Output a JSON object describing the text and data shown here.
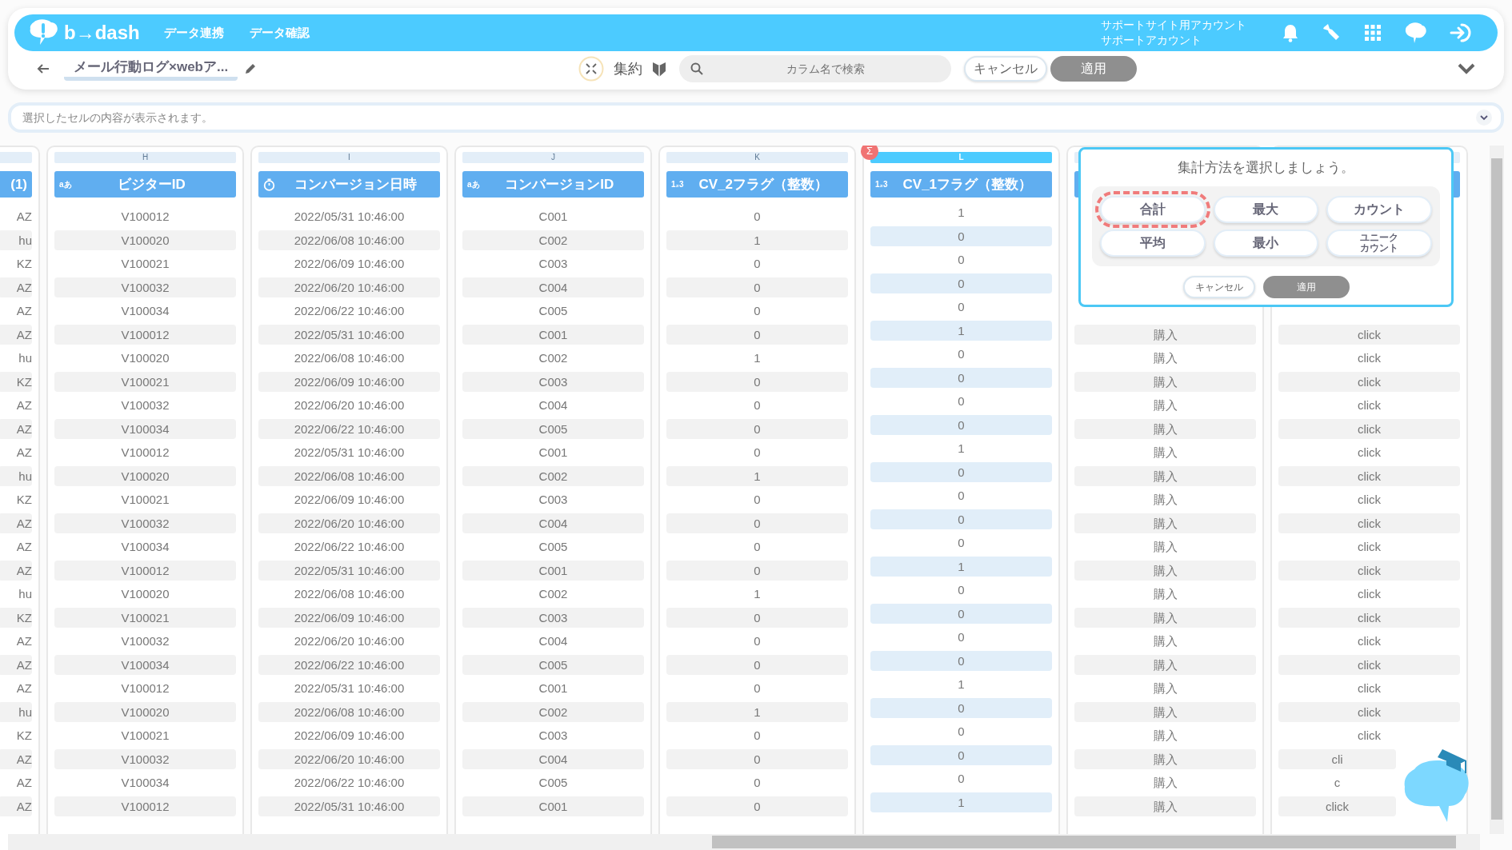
{
  "header": {
    "logo": "b→dash",
    "nav": [
      {
        "label": "データ連携"
      },
      {
        "label": "データ確認"
      }
    ],
    "account": [
      "サポートサイト用アカウント",
      "サポートアカウント"
    ]
  },
  "toolbar": {
    "title": "メール行動ログ×webア...",
    "aggregate_label": "集約",
    "search": {
      "placeholder": "カラム名で検索"
    },
    "buttons": [
      {
        "label": "キャンセル",
        "disabled": false
      },
      {
        "label": "適用",
        "disabled": true
      }
    ]
  },
  "cell_viewer": {
    "placeholder": "選択したセルの内容が表示されます。"
  },
  "table": {
    "columns": [
      {
        "title": "(1)",
        "selected": false
      },
      {
        "letter": "H",
        "kind": "text",
        "type_label": "aあ",
        "title": "ビジターID",
        "selected": false
      },
      {
        "letter": "I",
        "kind": "datetime",
        "title": "コンバージョン日時",
        "selected": false
      },
      {
        "letter": "J",
        "kind": "text",
        "type_label": "aあ",
        "title": "コンバージョンID",
        "selected": false
      },
      {
        "letter": "K",
        "kind": "number",
        "type_label": "1₂3",
        "title": "CV_2フラグ（整数）",
        "selected": false
      },
      {
        "letter": "L",
        "kind": "number",
        "type_label": "1₂3",
        "title": "CV_1フラグ（整数）",
        "selected": true,
        "badge": "Σ"
      },
      {
        "selected": false
      },
      {
        "selected": false
      }
    ],
    "rows": [
      [
        "AZ",
        "V100012",
        "2022/05/31 10:46:00",
        "C001",
        "0",
        "1"
      ],
      [
        "hu",
        "V100020",
        "2022/06/08 10:46:00",
        "C002",
        "1",
        "0"
      ],
      [
        "KZ",
        "V100021",
        "2022/06/09 10:46:00",
        "C003",
        "0",
        "0"
      ],
      [
        "AZ",
        "V100032",
        "2022/06/20 10:46:00",
        "C004",
        "0",
        "0"
      ],
      [
        "AZ",
        "V100034",
        "2022/06/22 10:46:00",
        "C005",
        "0",
        "0"
      ],
      [
        "AZ",
        "V100012",
        "2022/05/31 10:46:00",
        "C001",
        "0",
        "1",
        "購入",
        "click"
      ],
      [
        "hu",
        "V100020",
        "2022/06/08 10:46:00",
        "C002",
        "1",
        "0",
        "購入",
        "click"
      ],
      [
        "KZ",
        "V100021",
        "2022/06/09 10:46:00",
        "C003",
        "0",
        "0",
        "購入",
        "click"
      ],
      [
        "AZ",
        "V100032",
        "2022/06/20 10:46:00",
        "C004",
        "0",
        "0",
        "購入",
        "click"
      ],
      [
        "AZ",
        "V100034",
        "2022/06/22 10:46:00",
        "C005",
        "0",
        "0",
        "購入",
        "click"
      ],
      [
        "AZ",
        "V100012",
        "2022/05/31 10:46:00",
        "C001",
        "0",
        "1",
        "購入",
        "click"
      ],
      [
        "hu",
        "V100020",
        "2022/06/08 10:46:00",
        "C002",
        "1",
        "0",
        "購入",
        "click"
      ],
      [
        "KZ",
        "V100021",
        "2022/06/09 10:46:00",
        "C003",
        "0",
        "0",
        "購入",
        "click"
      ],
      [
        "AZ",
        "V100032",
        "2022/06/20 10:46:00",
        "C004",
        "0",
        "0",
        "購入",
        "click"
      ],
      [
        "AZ",
        "V100034",
        "2022/06/22 10:46:00",
        "C005",
        "0",
        "0",
        "購入",
        "click"
      ],
      [
        "AZ",
        "V100012",
        "2022/05/31 10:46:00",
        "C001",
        "0",
        "1",
        "購入",
        "click"
      ],
      [
        "hu",
        "V100020",
        "2022/06/08 10:46:00",
        "C002",
        "1",
        "0",
        "購入",
        "click"
      ],
      [
        "KZ",
        "V100021",
        "2022/06/09 10:46:00",
        "C003",
        "0",
        "0",
        "購入",
        "click"
      ],
      [
        "AZ",
        "V100032",
        "2022/06/20 10:46:00",
        "C004",
        "0",
        "0",
        "購入",
        "click"
      ],
      [
        "AZ",
        "V100034",
        "2022/06/22 10:46:00",
        "C005",
        "0",
        "0",
        "購入",
        "click"
      ],
      [
        "AZ",
        "V100012",
        "2022/05/31 10:46:00",
        "C001",
        "0",
        "1",
        "購入",
        "click"
      ],
      [
        "hu",
        "V100020",
        "2022/06/08 10:46:00",
        "C002",
        "1",
        "0",
        "購入",
        "click"
      ],
      [
        "KZ",
        "V100021",
        "2022/06/09 10:46:00",
        "C003",
        "0",
        "0",
        "購入",
        "click"
      ],
      [
        "AZ",
        "V100032",
        "2022/06/20 10:46:00",
        "C004",
        "0",
        "0",
        "購入",
        "cli"
      ],
      [
        "AZ",
        "V100034",
        "2022/06/22 10:46:00",
        "C005",
        "0",
        "0",
        "購入",
        "c"
      ],
      [
        "AZ",
        "V100012",
        "2022/05/31 10:46:00",
        "C001",
        "0",
        "1",
        "購入",
        "click"
      ]
    ]
  },
  "aggregate_popup": {
    "title": "集計方法を選択しましょう。",
    "options": [
      {
        "label": "合計",
        "selected": true
      },
      {
        "label": "最大",
        "selected": false
      },
      {
        "label": "カウント",
        "selected": false
      },
      {
        "label": "平均",
        "selected": false
      },
      {
        "label": "最小",
        "selected": false
      },
      {
        "label": "ユニークカウント",
        "selected": false
      }
    ],
    "buttons": [
      {
        "label": "キャンセル",
        "disabled": false
      },
      {
        "label": "適用",
        "disabled": true
      }
    ]
  }
}
